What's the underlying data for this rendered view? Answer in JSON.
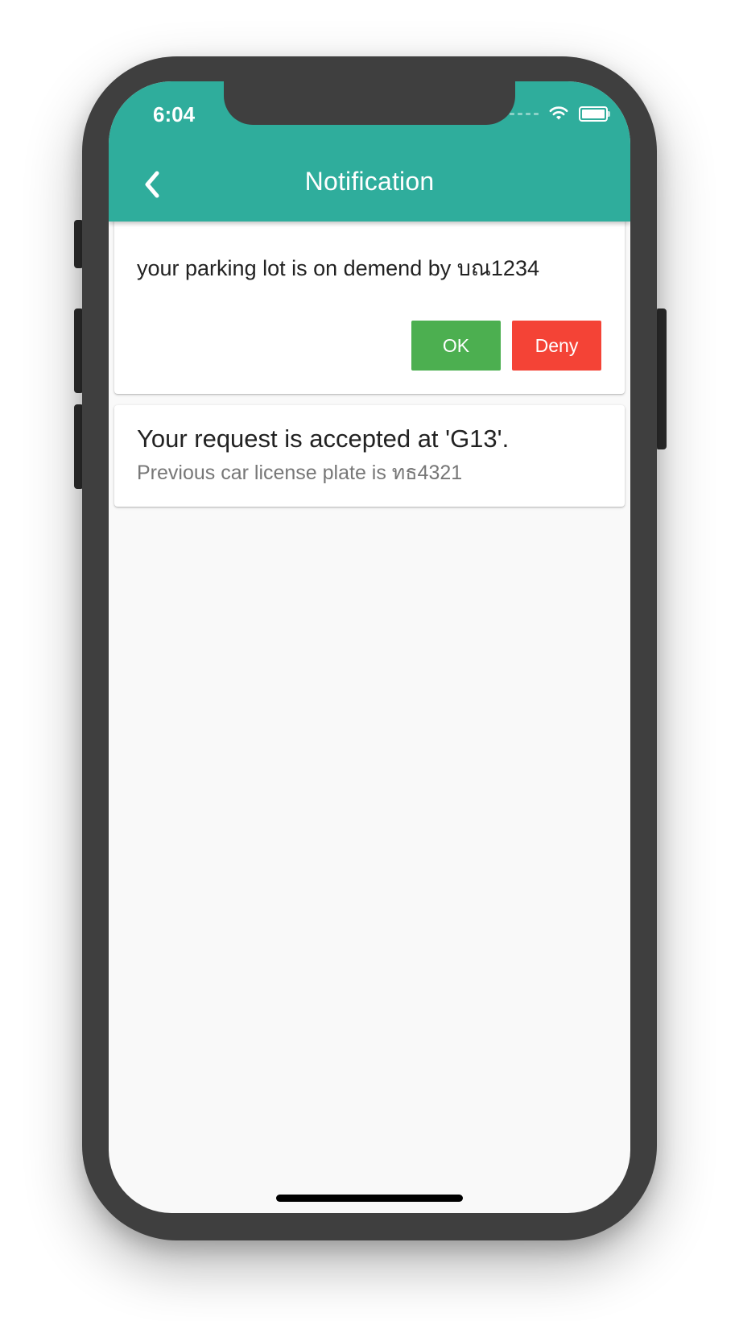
{
  "status_bar": {
    "time": "6:04"
  },
  "app_bar": {
    "title": "Notification",
    "back_icon": "chevron-left-icon"
  },
  "notifications": [
    {
      "message": "your parking lot is on demend by บณ1234",
      "ok_label": "OK",
      "deny_label": "Deny"
    },
    {
      "title": "Your request is accepted at 'G13'.",
      "subtitle": "Previous car license plate is ทธ4321"
    }
  ],
  "colors": {
    "primary": "#2fad9c",
    "ok": "#4caf50",
    "deny": "#f44336",
    "background": "#f9f9f9",
    "device": "#3f3f3f"
  }
}
